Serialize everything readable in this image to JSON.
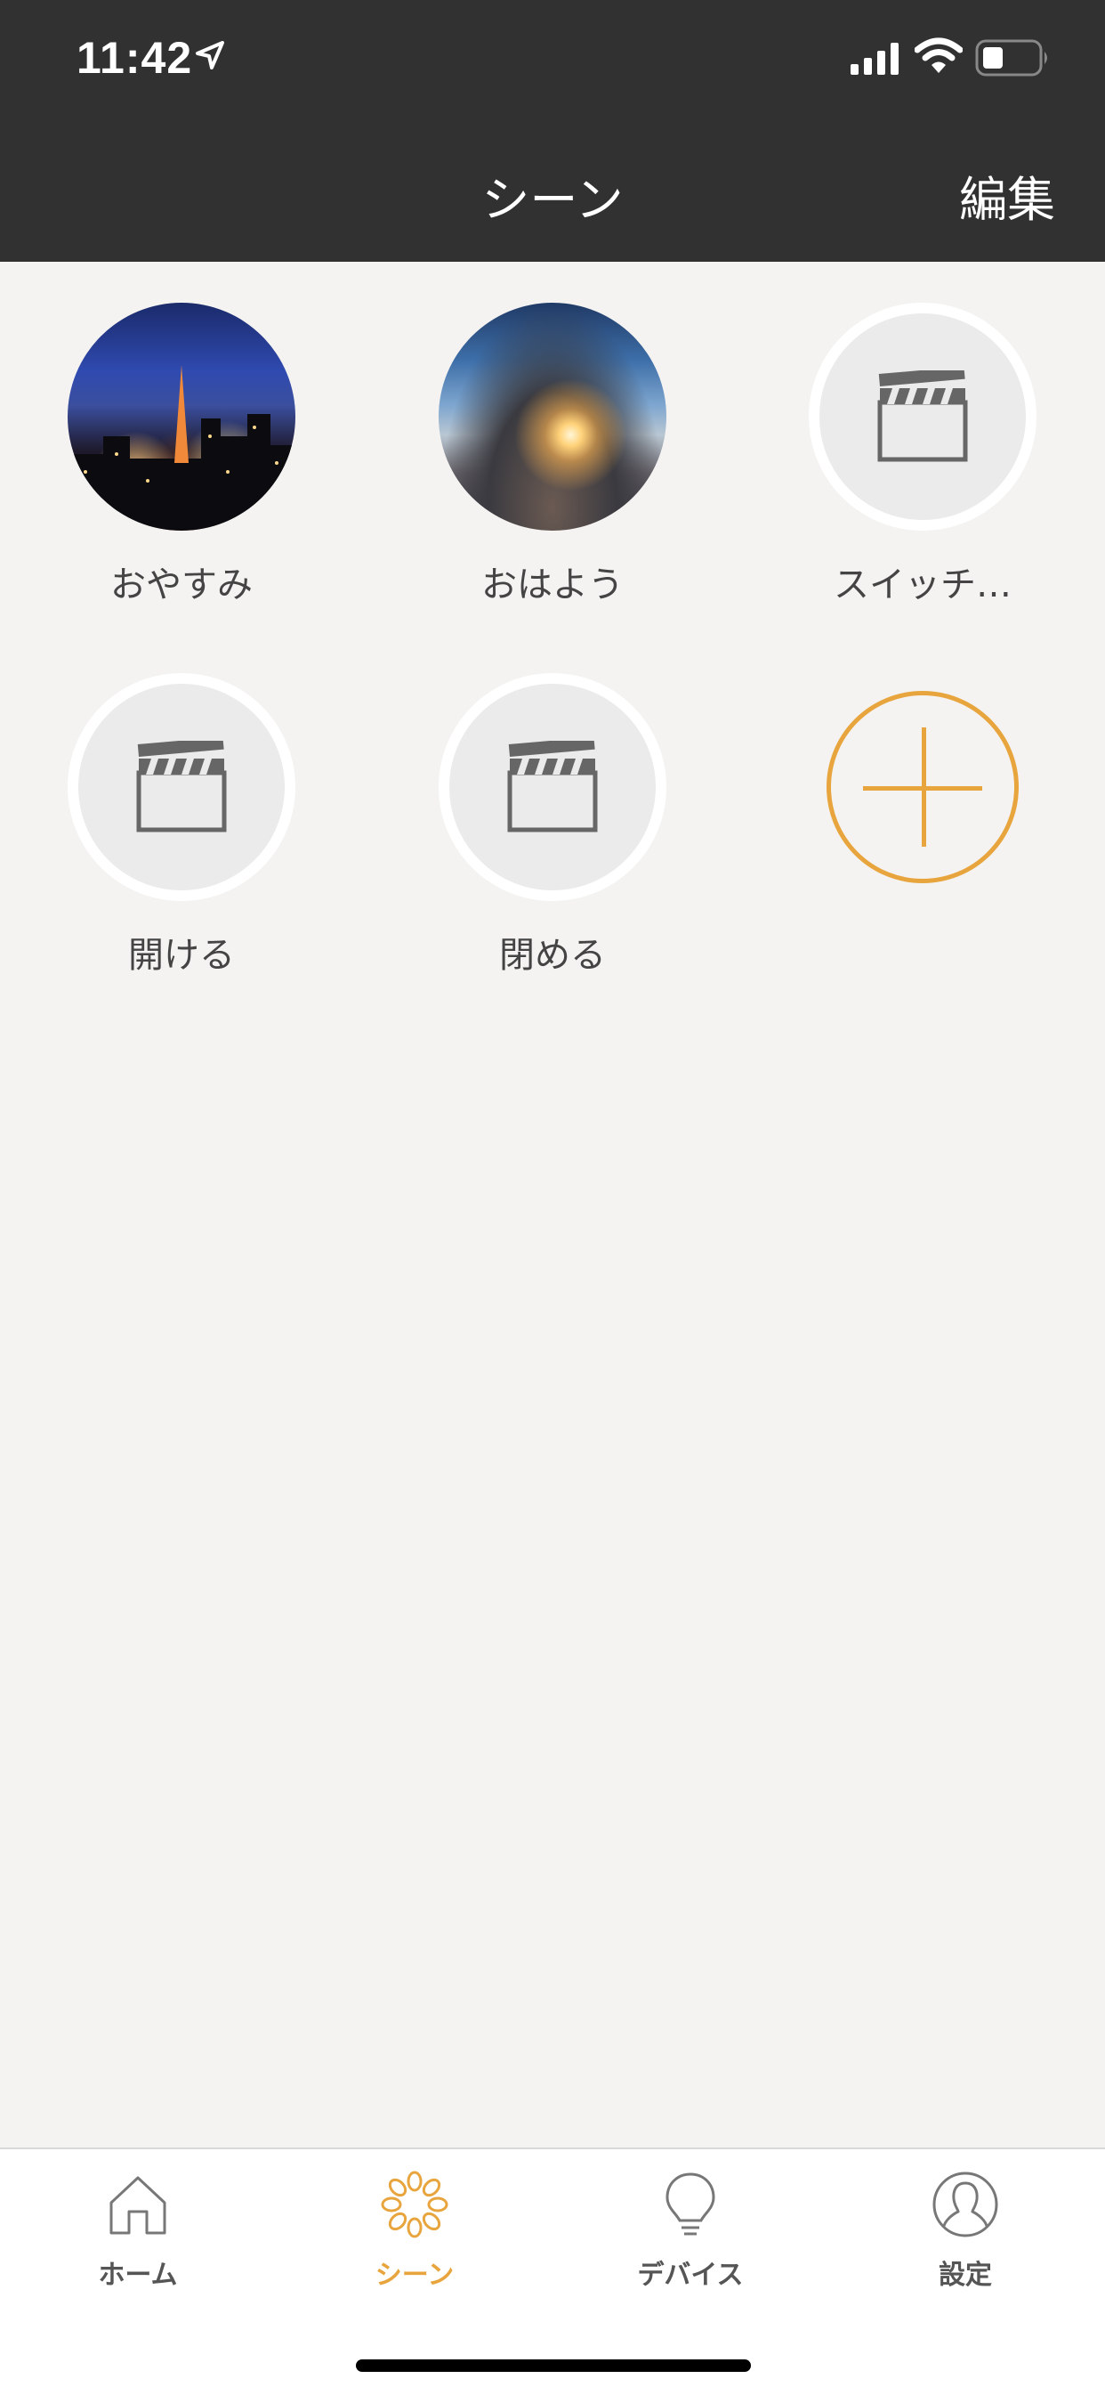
{
  "status_bar": {
    "time": "11:42"
  },
  "header": {
    "title": "シーン",
    "edit_label": "編集"
  },
  "scenes": [
    {
      "label": "おやすみ",
      "image": "night-city-photo"
    },
    {
      "label": "おはよう",
      "image": "sunrise-clouds-photo"
    },
    {
      "label": "スイッチ…",
      "icon": "clapperboard-icon"
    },
    {
      "label": "開ける",
      "icon": "clapperboard-icon"
    },
    {
      "label": "閉める",
      "icon": "clapperboard-icon"
    }
  ],
  "add_button": {
    "icon": "plus-icon",
    "color": "#e8a53e"
  },
  "tabs": [
    {
      "label": "ホーム",
      "icon": "home-icon",
      "active": false
    },
    {
      "label": "シーン",
      "icon": "flower-icon",
      "active": true
    },
    {
      "label": "デバイス",
      "icon": "lightbulb-icon",
      "active": false
    },
    {
      "label": "設定",
      "icon": "user-icon",
      "active": false
    }
  ],
  "colors": {
    "header_bg": "#313131",
    "accent": "#e8a53e",
    "background": "#f4f3f1"
  }
}
